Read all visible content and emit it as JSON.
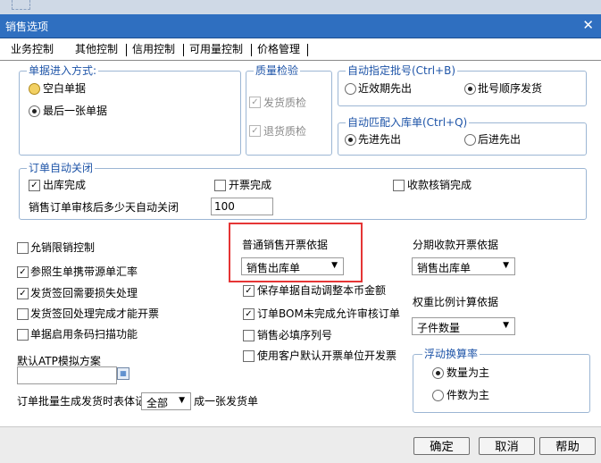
{
  "window": {
    "title": "销售选项"
  },
  "tabs": [
    "业务控制",
    "其他控制",
    "信用控制",
    "可用量控制",
    "价格管理"
  ],
  "entry_mode": {
    "title": "单据进入方式:",
    "options": [
      "空白单据",
      "最后一张单据"
    ]
  },
  "quality": {
    "title": "质量检验",
    "items": [
      "发货质检",
      "退货质检"
    ]
  },
  "batch": {
    "title": "自动指定批号(Ctrl+B)",
    "options": [
      "近效期先出",
      "批号顺序发货"
    ]
  },
  "match": {
    "title": "自动匹配入库单(Ctrl+Q)",
    "options": [
      "先进先出",
      "后进先出"
    ]
  },
  "auto_close": {
    "title": "订单自动关闭",
    "items": [
      "出库完成",
      "开票完成",
      "收款核销完成"
    ],
    "days_label": "销售订单审核后多少天自动关闭",
    "days_value": "100"
  },
  "left_checks": [
    "允销限销控制",
    "参照生单携带源单汇率",
    "发货签回需要损失处理",
    "发货签回处理完成才能开票",
    "单据启用条码扫描功能"
  ],
  "atp": {
    "label": "默认ATP模拟方案"
  },
  "batch_gen": {
    "prefix": "订单批量生成发货时表体记录",
    "value": "全部",
    "suffix": "成一张发货单"
  },
  "invoice_basis": {
    "label": "普通销售开票依据",
    "value": "销售出库单"
  },
  "mid_checks": [
    "保存单据自动调整本币金额",
    "订单BOM未完成允许审核订单",
    "销售必填序列号",
    "使用客户默认开票单位开发票"
  ],
  "installment": {
    "label": "分期收款开票依据",
    "value": "销售出库单"
  },
  "ratio": {
    "label": "权重比例计算依据",
    "value": "子件数量"
  },
  "float_unit": {
    "title": "浮动换算率",
    "options": [
      "数量为主",
      "件数为主"
    ]
  },
  "buttons": {
    "ok": "确定",
    "cancel": "取消",
    "help": "帮助"
  },
  "icons": {
    "close": "close-icon",
    "calendar": "calendar-icon",
    "dropdown": "chevron-down-icon"
  },
  "colors": {
    "titlebar": "#2f6fc0",
    "group_title": "#1f55a8",
    "highlight_box": "#e53535"
  }
}
